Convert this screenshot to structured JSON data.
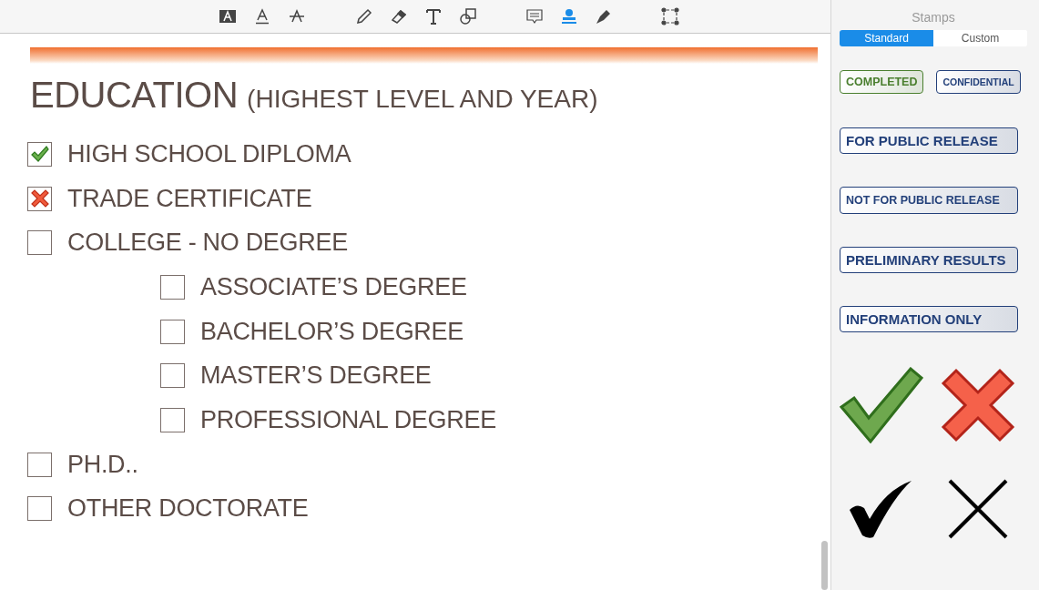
{
  "toolbar": {
    "tools": [
      {
        "kind": "text-box",
        "selected": false
      },
      {
        "kind": "underline",
        "selected": false
      },
      {
        "kind": "strike",
        "selected": false
      },
      {
        "kind": "pencil",
        "selected": false
      },
      {
        "kind": "eraser",
        "selected": false
      },
      {
        "kind": "text",
        "selected": false
      },
      {
        "kind": "shapes",
        "selected": false
      },
      {
        "kind": "note",
        "selected": false
      },
      {
        "kind": "stamp",
        "selected": true
      },
      {
        "kind": "pen",
        "selected": false
      },
      {
        "kind": "select",
        "selected": false
      }
    ]
  },
  "document": {
    "title": "EDUCATION",
    "subtitle": "(HIGHEST LEVEL AND YEAR)",
    "items": [
      {
        "label": "HIGH SCHOOL DIPLOMA",
        "kind": "check"
      },
      {
        "label": "TRADE CERTIFICATE",
        "kind": "cross"
      },
      {
        "label": "COLLEGE - NO DEGREE",
        "kind": "empty",
        "children": [
          {
            "label": "ASSOCIATE’S DEGREE",
            "kind": "empty"
          },
          {
            "label": "BACHELOR’S DEGREE",
            "kind": "empty"
          },
          {
            "label": "MASTER’S DEGREE",
            "kind": "empty"
          },
          {
            "label": "PROFESSIONAL DEGREE",
            "kind": "empty"
          }
        ]
      },
      {
        "label": "PH.D..",
        "kind": "empty"
      },
      {
        "label": "OTHER DOCTORATE",
        "kind": "empty"
      }
    ]
  },
  "stamps_panel": {
    "title": "Stamps",
    "tabs": [
      {
        "label": "Standard",
        "selected": true
      },
      {
        "label": "Custom",
        "selected": false
      }
    ],
    "text_stamps": [
      {
        "label": "COMPLETED",
        "color": "#4a7f2e",
        "kind": "badge"
      },
      {
        "label": "CONFIDENTIAL",
        "color": "#23407a",
        "kind": "tiny"
      },
      {
        "label": "FOR PUBLIC RELEASE",
        "color": "#23407a",
        "kind": "banner"
      },
      {
        "label": "NOT FOR PUBLIC RELEASE",
        "color": "#23407a",
        "kind": "narrow"
      },
      {
        "label": "PRELIMINARY RESULTS",
        "color": "#23407a",
        "kind": "banner"
      },
      {
        "label": "INFORMATION ONLY",
        "color": "#23407a",
        "kind": "banner"
      }
    ],
    "image_stamps": [
      {
        "kind": "check"
      },
      {
        "kind": "cross"
      },
      {
        "kind": "tick"
      },
      {
        "kind": "x"
      }
    ]
  }
}
